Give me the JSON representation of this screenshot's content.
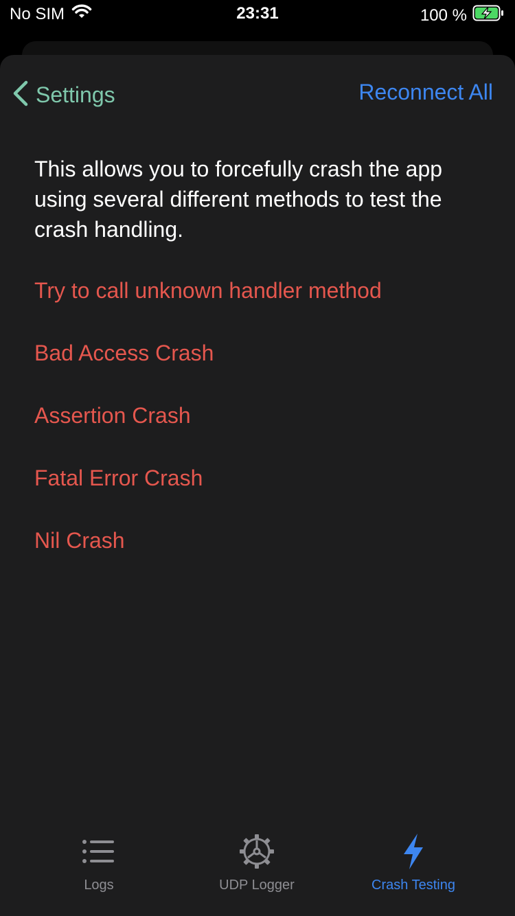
{
  "status_bar": {
    "carrier": "No SIM",
    "time": "23:31",
    "battery_percent": "100 %",
    "battery_level": 1.0
  },
  "nav": {
    "back_label": "Settings",
    "action_label": "Reconnect All"
  },
  "description": "This allows you to forcefully crash the app using several different methods to test the crash handling.",
  "crash_options": [
    "Try to call unknown handler method",
    "Bad Access Crash",
    "Assertion Crash",
    "Fatal Error Crash",
    "Nil Crash"
  ],
  "tabs": [
    {
      "label": "Logs",
      "icon": "list-icon",
      "active": false
    },
    {
      "label": "UDP Logger",
      "icon": "gear-icon",
      "active": false
    },
    {
      "label": "Crash Testing",
      "icon": "bolt-icon",
      "active": true
    }
  ],
  "colors": {
    "background": "#1d1d1e",
    "back_tint": "#7fc8ac",
    "accent_blue": "#3d86f0",
    "destructive_red": "#e5574e",
    "inactive_tab": "#8e8e93",
    "battery_green": "#4cd964"
  }
}
